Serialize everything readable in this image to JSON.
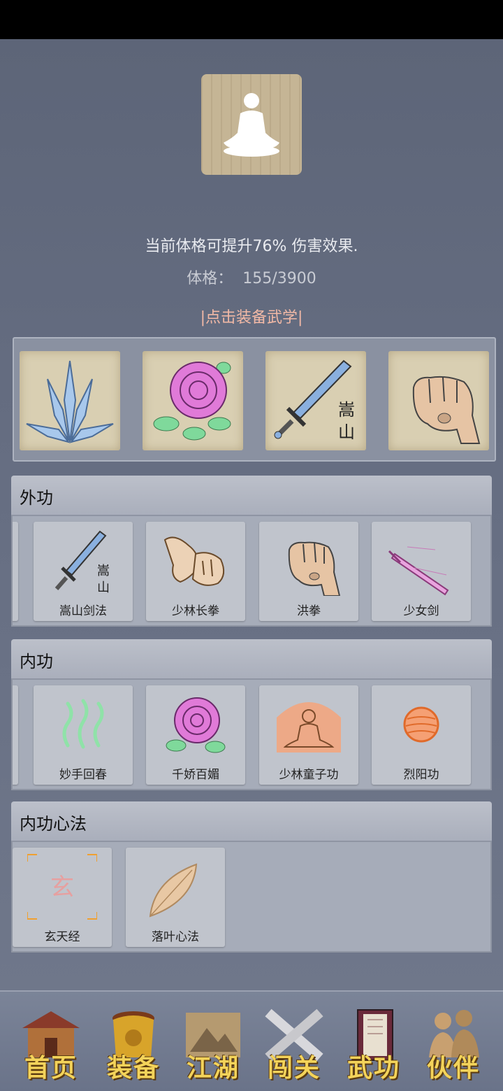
{
  "header": {
    "effect_text": "当前体格可提升76% 伤害效果.",
    "stat_label": "体格：",
    "stat_value": "155/3900",
    "equip_link": "|点击装备武学|"
  },
  "equipped": [
    {
      "name": "crystal-spikes"
    },
    {
      "name": "rose"
    },
    {
      "name": "songshan-sword",
      "glyph_top": "嵩",
      "glyph_bottom": "山"
    },
    {
      "name": "fist"
    }
  ],
  "sections": {
    "waigong": {
      "title": "外功",
      "skills": [
        "嵩山剑法",
        "少林长拳",
        "洪拳",
        "少女剑"
      ],
      "songshan_glyph_top": "嵩",
      "songshan_glyph_bottom": "山"
    },
    "neigong": {
      "title": "内功",
      "skills": [
        "妙手回春",
        "千娇百媚",
        "少林童子功",
        "烈阳功"
      ]
    },
    "xinfa": {
      "title": "内功心法",
      "skills": [
        "玄天经",
        "落叶心法"
      ],
      "xuan_glyph": "玄"
    }
  },
  "nav": [
    {
      "label": "首页",
      "icon": "house-icon"
    },
    {
      "label": "装备",
      "icon": "armor-icon"
    },
    {
      "label": "江湖",
      "icon": "scroll-map-icon"
    },
    {
      "label": "闯关",
      "icon": "crossed-swords-icon"
    },
    {
      "label": "武功",
      "icon": "book-icon"
    },
    {
      "label": "伙伴",
      "icon": "companions-icon"
    }
  ],
  "colors": {
    "background": "#626a7c",
    "link": "#f2b9a6",
    "nav_label": "#f3d35a"
  }
}
